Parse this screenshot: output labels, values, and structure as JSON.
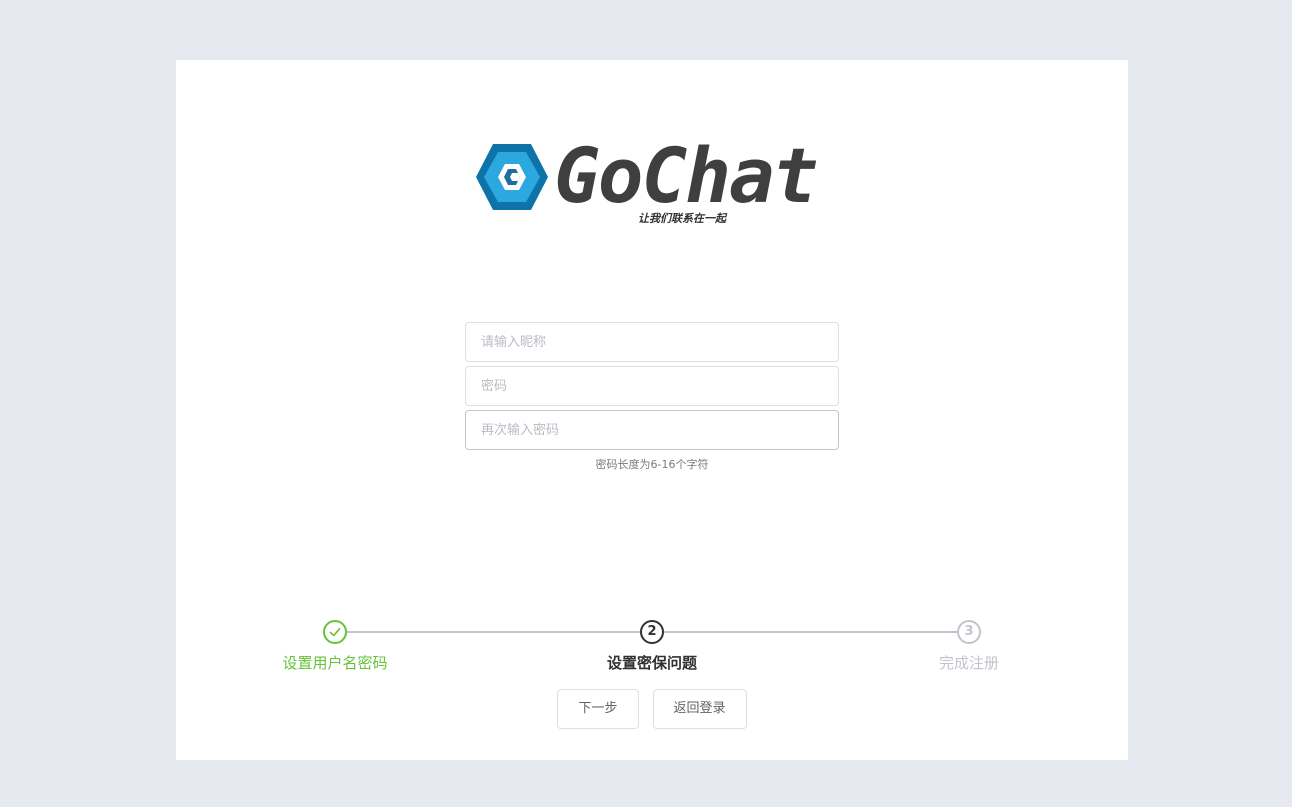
{
  "logo": {
    "wordmark": "GoChat",
    "slogan": "让我们联系在一起",
    "colors": {
      "hex_outer": "#0e73a8",
      "hex_mid": "#2ba8dd",
      "hex_inner": "#ffffff",
      "wordmark": "#3f3f3f"
    }
  },
  "form": {
    "nickname": {
      "placeholder": "请输入昵称",
      "value": ""
    },
    "password": {
      "placeholder": "密码",
      "value": ""
    },
    "confirm_password": {
      "placeholder": "再次输入密码",
      "value": ""
    },
    "hint": "密码长度为6-16个字符"
  },
  "steps": [
    {
      "index": "1",
      "title": "设置用户名密码",
      "status": "success",
      "icon": "check-icon"
    },
    {
      "index": "2",
      "title": "设置密保问题",
      "status": "process"
    },
    {
      "index": "3",
      "title": "完成注册",
      "status": "wait"
    }
  ],
  "buttons": {
    "next_label": "下一步",
    "back_label": "返回登录"
  },
  "colors": {
    "page_bg": "#e6e9f0",
    "card_bg": "#ffffff",
    "success": "#67c23a",
    "process": "#303133",
    "wait": "#c0c4cc"
  }
}
